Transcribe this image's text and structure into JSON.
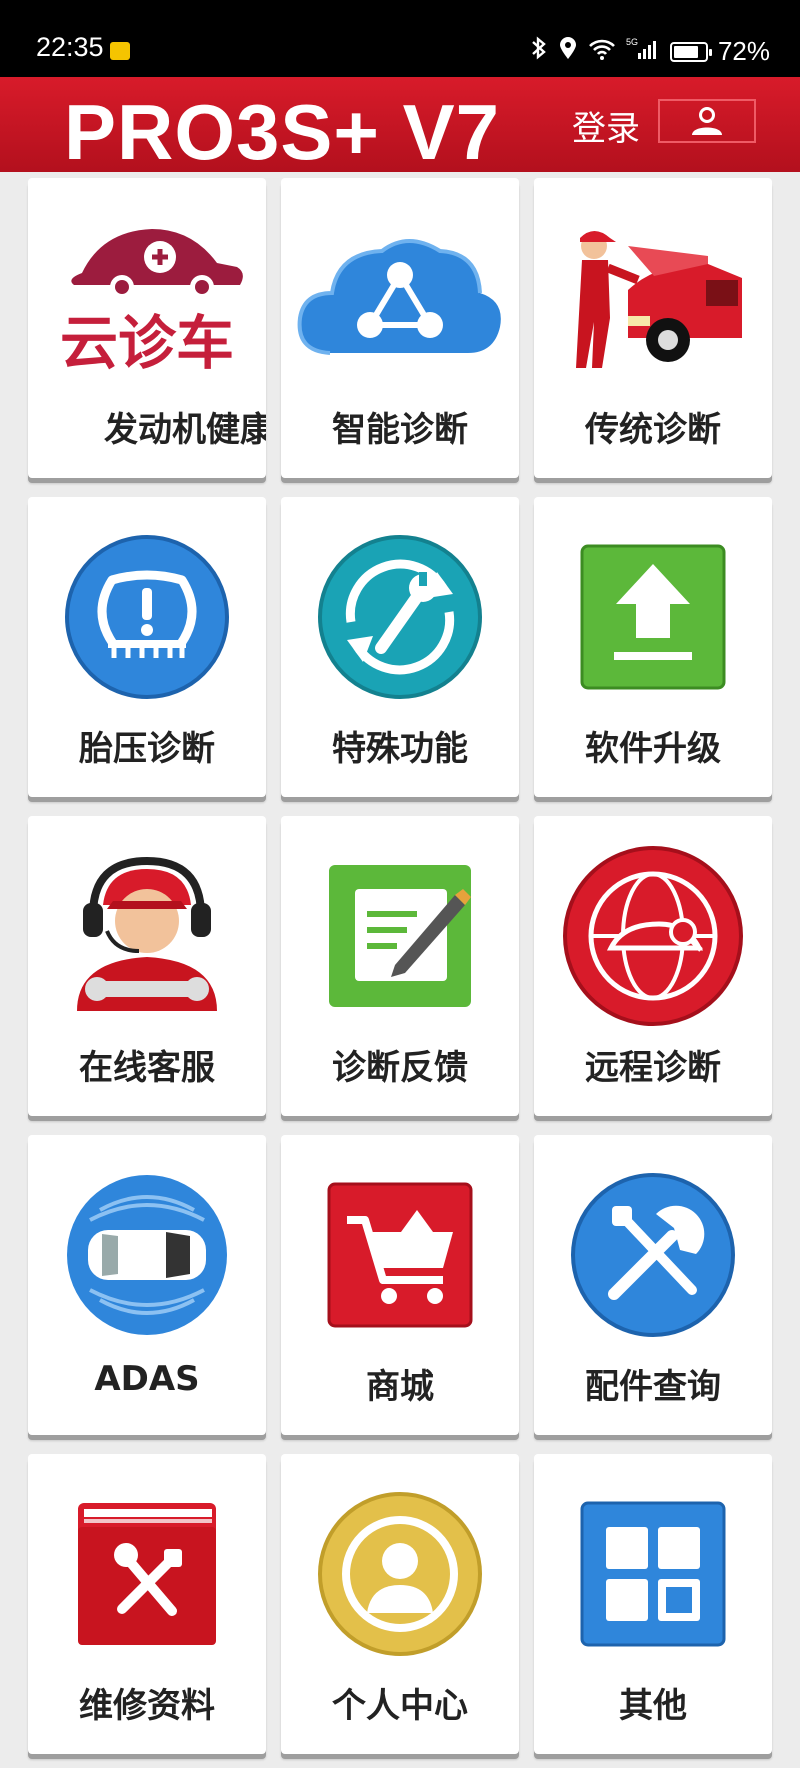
{
  "status_bar": {
    "time": "22:35",
    "network": "5G",
    "battery": "72%"
  },
  "header": {
    "title": "PRO3S+ V7",
    "login_label": "登录"
  },
  "tiles": [
    {
      "label": "发动机健康",
      "icon": "cloud-diagnosis-logo-icon",
      "logo_text": "云诊车"
    },
    {
      "label": "智能诊断",
      "icon": "cloud-share-icon"
    },
    {
      "label": "传统诊断",
      "icon": "mechanic-car-icon"
    },
    {
      "label": "胎压诊断",
      "icon": "tire-pressure-icon"
    },
    {
      "label": "特殊功能",
      "icon": "wrench-refresh-icon"
    },
    {
      "label": "软件升级",
      "icon": "upload-icon"
    },
    {
      "label": "在线客服",
      "icon": "support-agent-icon"
    },
    {
      "label": "诊断反馈",
      "icon": "feedback-note-icon"
    },
    {
      "label": "远程诊断",
      "icon": "remote-globe-car-icon"
    },
    {
      "label": "ADAS",
      "icon": "adas-car-icon"
    },
    {
      "label": "商城",
      "icon": "shopping-cart-icon"
    },
    {
      "label": "配件查询",
      "icon": "parts-tools-icon"
    },
    {
      "label": "维修资料",
      "icon": "repair-manual-icon"
    },
    {
      "label": "个人中心",
      "icon": "user-profile-icon"
    },
    {
      "label": "其他",
      "icon": "other-grid-icon"
    }
  ],
  "colors": {
    "brand_red": "#c8141f",
    "blue": "#2b7fd6",
    "green": "#5cb83a",
    "gold": "#e3c04a"
  }
}
